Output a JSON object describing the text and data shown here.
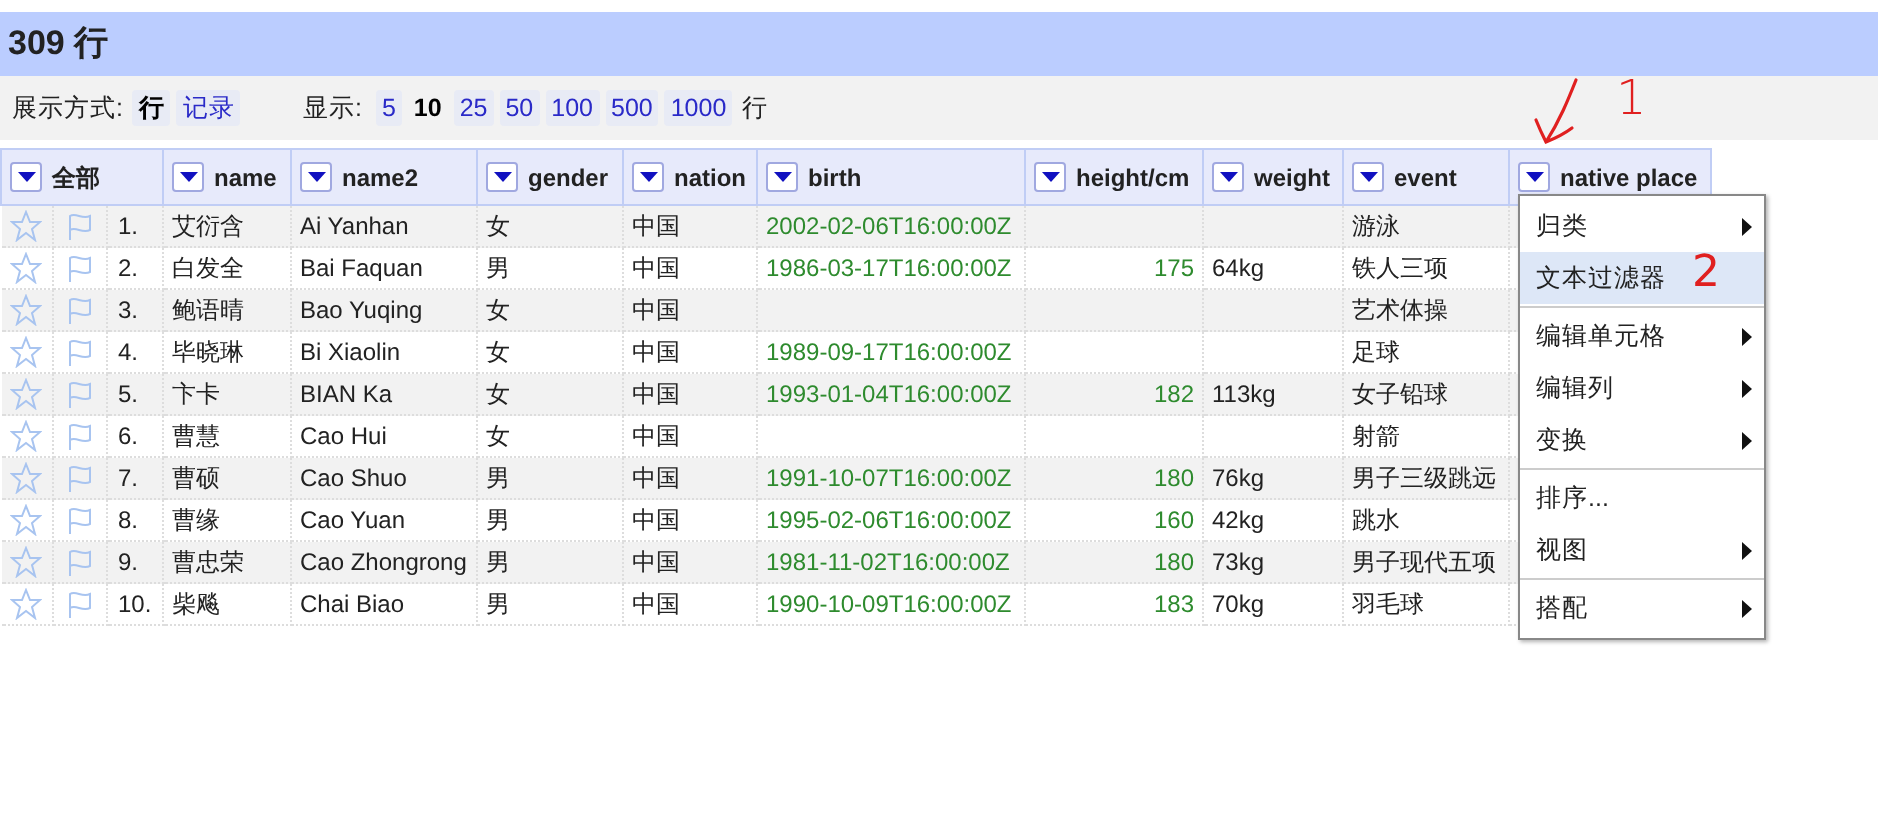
{
  "title": "309 行",
  "toolbar": {
    "mode_label": "展示方式:",
    "modes": [
      {
        "label": "行",
        "selected": true
      },
      {
        "label": "记录",
        "selected": false
      }
    ],
    "show_label": "显示:",
    "sizes": [
      {
        "label": "5",
        "selected": false
      },
      {
        "label": "10",
        "selected": true
      },
      {
        "label": "25",
        "selected": false
      },
      {
        "label": "50",
        "selected": false
      },
      {
        "label": "100",
        "selected": false
      },
      {
        "label": "500",
        "selected": false
      },
      {
        "label": "1000",
        "selected": false
      }
    ],
    "unit": "行"
  },
  "table": {
    "all_label": "全部",
    "columns": [
      {
        "label": "name",
        "kind": "text"
      },
      {
        "label": "name2",
        "kind": "text"
      },
      {
        "label": "gender",
        "kind": "text"
      },
      {
        "label": "nation",
        "kind": "text"
      },
      {
        "label": "birth",
        "kind": "date"
      },
      {
        "label": "height/cm",
        "kind": "number"
      },
      {
        "label": "weight",
        "kind": "text"
      },
      {
        "label": "event",
        "kind": "text"
      },
      {
        "label": "native place",
        "kind": "text"
      }
    ],
    "rows": [
      {
        "index": "1.",
        "cells": [
          "艾衍含",
          "Ai Yanhan",
          "女",
          "中国",
          "2002-02-06T16:00:00Z",
          "",
          "",
          "游泳",
          ""
        ]
      },
      {
        "index": "2.",
        "cells": [
          "白发全",
          "Bai Faquan",
          "男",
          "中国",
          "1986-03-17T16:00:00Z",
          "175",
          "64kg",
          "铁人三项",
          ""
        ]
      },
      {
        "index": "3.",
        "cells": [
          "鲍语晴",
          "Bao Yuqing",
          "女",
          "中国",
          "",
          "",
          "",
          "艺术体操",
          ""
        ]
      },
      {
        "index": "4.",
        "cells": [
          "毕晓琳",
          "Bi Xiaolin",
          "女",
          "中国",
          "1989-09-17T16:00:00Z",
          "",
          "",
          "足球",
          ""
        ]
      },
      {
        "index": "5.",
        "cells": [
          "卞卡",
          "BIAN Ka",
          "女",
          "中国",
          "1993-01-04T16:00:00Z",
          "182",
          "113kg",
          "女子铅球",
          ""
        ]
      },
      {
        "index": "6.",
        "cells": [
          "曹慧",
          "Cao Hui",
          "女",
          "中国",
          "",
          "",
          "",
          "射箭",
          ""
        ]
      },
      {
        "index": "7.",
        "cells": [
          "曹硕",
          "Cao Shuo",
          "男",
          "中国",
          "1991-10-07T16:00:00Z",
          "180",
          "76kg",
          "男子三级跳远",
          ""
        ]
      },
      {
        "index": "8.",
        "cells": [
          "曹缘",
          "Cao Yuan",
          "男",
          "中国",
          "1995-02-06T16:00:00Z",
          "160",
          "42kg",
          "跳水",
          ""
        ]
      },
      {
        "index": "9.",
        "cells": [
          "曹忠荣",
          "Cao Zhongrong",
          "男",
          "中国",
          "1981-11-02T16:00:00Z",
          "180",
          "73kg",
          "男子现代五项",
          ""
        ]
      },
      {
        "index": "10.",
        "cells": [
          "柴飚",
          "Chai Biao",
          "男",
          "中国",
          "1990-10-09T16:00:00Z",
          "183",
          "70kg",
          "羽毛球",
          ""
        ]
      }
    ]
  },
  "menu": {
    "groups": [
      [
        {
          "label": "归类",
          "submenu": true,
          "selected": false
        },
        {
          "label": "文本过滤器",
          "submenu": false,
          "selected": true
        }
      ],
      [
        {
          "label": "编辑单元格",
          "submenu": true,
          "selected": false
        },
        {
          "label": "编辑列",
          "submenu": true,
          "selected": false
        },
        {
          "label": "变换",
          "submenu": true,
          "selected": false
        }
      ],
      [
        {
          "label": "排序...",
          "submenu": false,
          "selected": false
        },
        {
          "label": "视图",
          "submenu": true,
          "selected": false
        }
      ],
      [
        {
          "label": "搭配",
          "submenu": true,
          "selected": false
        }
      ]
    ]
  },
  "annotations": [
    {
      "text": "1"
    },
    {
      "text": "2"
    }
  ]
}
